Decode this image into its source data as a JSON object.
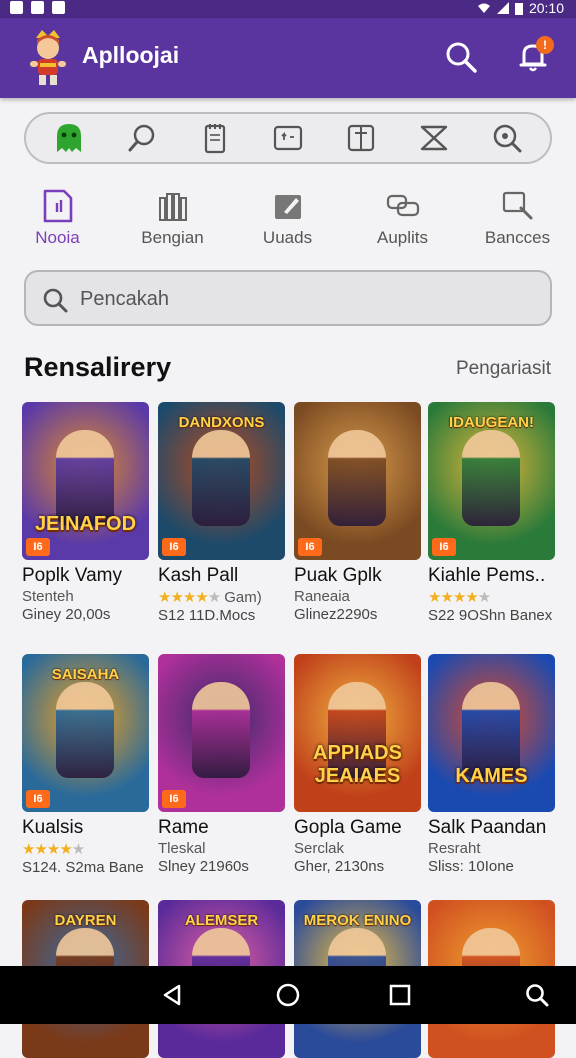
{
  "status_bar": {
    "left_icons": [
      "g-icon",
      "box-icon",
      "square-icon"
    ],
    "time": "20:10"
  },
  "app": {
    "title": "Aplloojai",
    "notification_badge": "!"
  },
  "toolbar_icons": [
    "ghost-icon",
    "search-icon",
    "notepad-icon",
    "share-icon",
    "frame-icon",
    "cross-icon",
    "search-circle-icon"
  ],
  "categories": [
    {
      "label": "Nooia",
      "icon": "document-icon",
      "active": true
    },
    {
      "label": "Bengian",
      "icon": "books-icon",
      "active": false
    },
    {
      "label": "Uuads",
      "icon": "pencil-icon",
      "active": false
    },
    {
      "label": "Auplits",
      "icon": "link-icon",
      "active": false
    },
    {
      "label": "Bancces",
      "icon": "magnifier-icon",
      "active": false
    }
  ],
  "search": {
    "placeholder": "Pencakah"
  },
  "section": {
    "title": "Rensalirery",
    "link": "Pengariasit"
  },
  "games": [
    {
      "name": "Poplk Vamy",
      "sub": "Stenteh",
      "price": "Giney 20,00s",
      "rating": null,
      "art_top": "",
      "art_big": "JEINAFOD",
      "badge": "I6",
      "colors": [
        "#5a3aa8",
        "#e08a2c"
      ]
    },
    {
      "name": "Kash Pall",
      "sub": "Gam)",
      "price": "S12 11D.Mocs",
      "rating": 3.5,
      "art_top": "DANDXONS",
      "art_big": "",
      "badge": "I6",
      "colors": [
        "#1d4a6a",
        "#b84a1e"
      ]
    },
    {
      "name": "Puak Gplk",
      "sub": "Raneaia",
      "price": "Glinez2290s",
      "rating": null,
      "art_top": "",
      "art_big": "",
      "badge": "I6",
      "colors": [
        "#7a4a22",
        "#d89a4a"
      ]
    },
    {
      "name": "Kiahle Pems..",
      "sub": "",
      "price": "S22 9OShn Banex",
      "rating": 4,
      "art_top": "IDAUGEAN!",
      "art_big": "",
      "badge": "I6",
      "colors": [
        "#2a7a3a",
        "#e0b63a"
      ]
    },
    {
      "name": "Kualsis",
      "sub": "",
      "price": "S124. S2ma Bane",
      "rating": 4,
      "art_top": "SAISAHA",
      "art_big": "",
      "badge": "I6",
      "colors": [
        "#2a6a9a",
        "#f0a020"
      ]
    },
    {
      "name": "Rame",
      "sub": "Tleskal",
      "price": "Slney 21960s",
      "rating": null,
      "art_top": "",
      "art_big": "",
      "badge": "I6",
      "colors": [
        "#b0309a",
        "#3a2a6a"
      ]
    },
    {
      "name": "Gopla Game",
      "sub": "Serclak",
      "price": "Gher, 2130ns",
      "rating": null,
      "art_top": "",
      "art_big": "APPIADS JEAIAES",
      "badge": "",
      "colors": [
        "#c0401a",
        "#f0b040"
      ]
    },
    {
      "name": "Salk Paandan",
      "sub": "Resraht",
      "price": "Sliss: 10Ione",
      "rating": null,
      "art_top": "",
      "art_big": "KAMES",
      "badge": "",
      "colors": [
        "#1a4ab0",
        "#e04a2a"
      ]
    },
    {
      "name": "",
      "sub": "",
      "price": "",
      "rating": null,
      "art_top": "DAYREN",
      "art_big": "",
      "badge": "",
      "colors": [
        "#7a3a1a",
        "#3a6aa0"
      ]
    },
    {
      "name": "",
      "sub": "",
      "price": "",
      "rating": null,
      "art_top": "ALEMSER",
      "art_big": "",
      "badge": "",
      "colors": [
        "#5a2a9a",
        "#e060a0"
      ]
    },
    {
      "name": "",
      "sub": "",
      "price": "",
      "rating": null,
      "art_top": "MEROK ENINO",
      "art_big": "",
      "badge": "",
      "colors": [
        "#2a4a9a",
        "#f0c040"
      ]
    },
    {
      "name": "",
      "sub": "",
      "price": "",
      "rating": null,
      "art_top": "",
      "art_big": "",
      "badge": "",
      "colors": [
        "#d05020",
        "#f0a030"
      ]
    }
  ],
  "colors": {
    "appbar": "#5a35a0",
    "accent": "#7b3fb9",
    "star": "#f2b01e"
  },
  "nav_icons": [
    "back-icon",
    "home-icon",
    "recents-icon",
    "search-icon"
  ]
}
